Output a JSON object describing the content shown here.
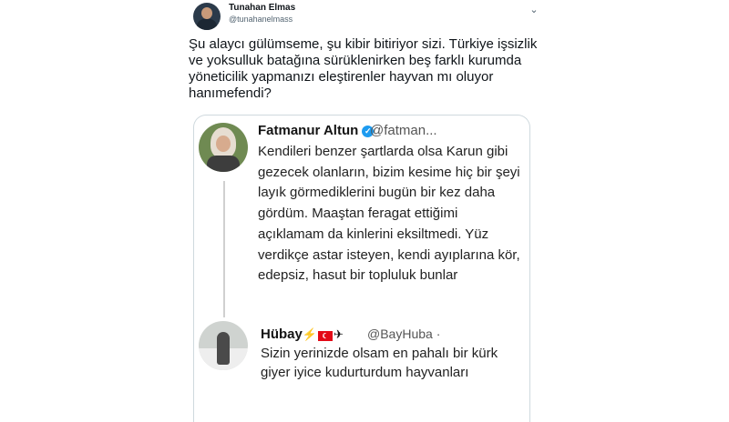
{
  "tweet": {
    "author_name": "Tunahan Elmas",
    "author_handle": "@tunahanelmass",
    "caret_icon": "chevron-down-icon",
    "text": "Şu alaycı gülümseme, şu kibir bitiriyor sizi. Türkiye işsizlik ve yoksulluk batağına sürüklenirken beş farklı kurumda yöneticilik yapmanızı eleştirenler hayvan mı oluyor hanımefendi?"
  },
  "quoted_image": {
    "post1": {
      "name": "Fatmanur Altun",
      "verified_icon": "verified-badge-icon",
      "handle": "@fatman...",
      "text": "Kendileri benzer şartlarda olsa Karun gibi gezecek olanların, bizim kesime hiç bir şeyi layık görmediklerini bugün bir kez daha gördüm. Maaştan feragat ettiğimi açıklamam da kinlerini eksiltmedi. Yüz verdikçe astar isteyen, kendi ayıplarına kör, edepsiz, hasut bir topluluk bunlar"
    },
    "post2": {
      "name": "Hübay",
      "emojis": "⚡",
      "flag": "☾",
      "plane": "✈",
      "handle": "@BayHuba ·",
      "text": "Sizin yerinizde olsam en pahalı  bir kürk giyer iyice kudurturdum hayvanları"
    }
  },
  "colors": {
    "accent": "#1d9bf0",
    "text": "#0f1419",
    "muted": "#536471"
  }
}
